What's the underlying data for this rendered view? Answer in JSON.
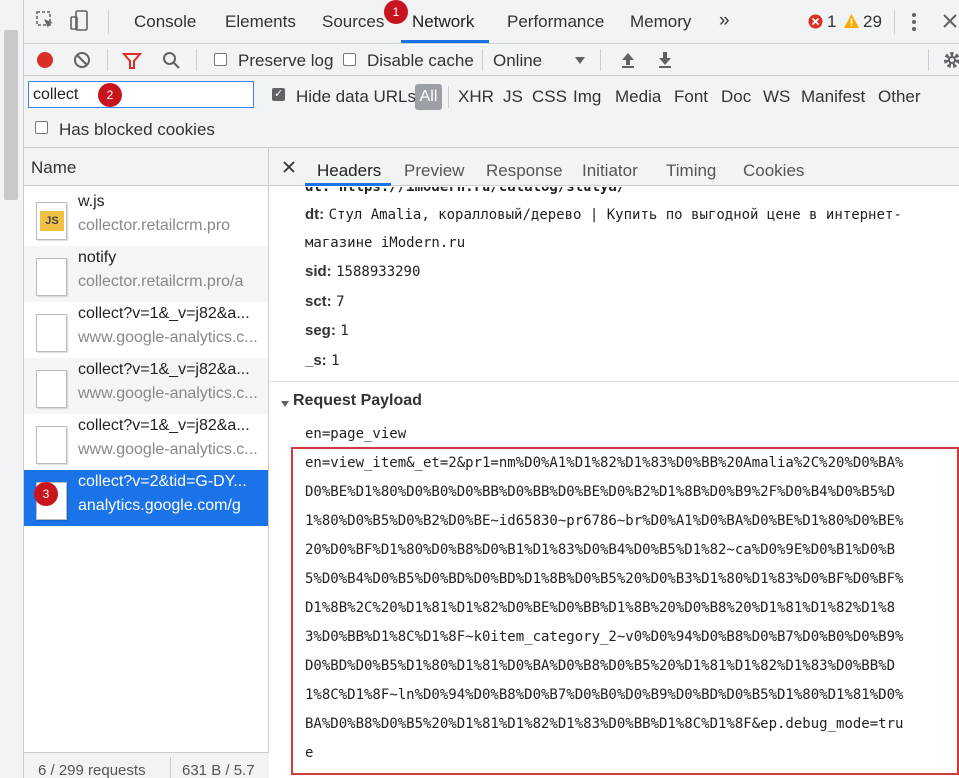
{
  "top_tabs": {
    "console": "Console",
    "elements": "Elements",
    "sources": "Sources",
    "network": "Network",
    "performance": "Performance",
    "memory": "Memory",
    "more": "»",
    "errors": "1",
    "warnings": "29"
  },
  "badges": {
    "one": "1",
    "two": "2",
    "three": "3"
  },
  "toolbar": {
    "preserve_log": "Preserve log",
    "disable_cache": "Disable cache",
    "throttle": "Online"
  },
  "filter": {
    "value": "collect",
    "hide_data_urls": "Hide data URLs",
    "types": [
      "All",
      "XHR",
      "JS",
      "CSS",
      "Img",
      "Media",
      "Font",
      "Doc",
      "WS",
      "Manifest",
      "Other"
    ],
    "blocked_cookies": "Has blocked cookies"
  },
  "requests": {
    "header": "Name",
    "items": [
      {
        "name": "w.js",
        "host": "collector.retailcrm.pro"
      },
      {
        "name": "notify",
        "host": "collector.retailcrm.pro/a"
      },
      {
        "name": "collect?v=1&_v=j82&a...",
        "host": "www.google-analytics.c..."
      },
      {
        "name": "collect?v=1&_v=j82&a...",
        "host": "www.google-analytics.c..."
      },
      {
        "name": "collect?v=1&_v=j82&a...",
        "host": "www.google-analytics.c..."
      },
      {
        "name": "collect?v=2&tid=G-DY...",
        "host": "analytics.google.com/g"
      }
    ],
    "status": "6 / 299 requests",
    "size": "631 B / 5.7"
  },
  "detail_tabs": [
    "Headers",
    "Preview",
    "Response",
    "Initiator",
    "Timing",
    "Cookies"
  ],
  "params": {
    "dl_partial": "dl: https://imodern.ru/catalog/stulya/",
    "dt_key": "dt:",
    "dt_val": "Стул Amalia, коралловый/дерево | Купить по выгодной цене в интернет-",
    "dt_val2": "магазине iModern.ru",
    "sid_key": "sid:",
    "sid_val": "1588933290",
    "sct_key": "sct:",
    "sct_val": "7",
    "seg_key": "seg:",
    "seg_val": "1",
    "s_key": "_s:",
    "s_val": "1"
  },
  "payload": {
    "title": "Request Payload",
    "lines": [
      "en=page_view",
      "en=view_item&_et=2&pr1=nm%D0%A1%D1%82%D1%83%D0%BB%20Amalia%2C%20%D0%BA%",
      "D0%BE%D1%80%D0%B0%D0%BB%D0%BB%D0%BE%D0%B2%D1%8B%D0%B9%2F%D0%B4%D0%B5%D",
      "1%80%D0%B5%D0%B2%D0%BE~id65830~pr6786~br%D0%A1%D0%BA%D0%BE%D1%80%D0%BE%",
      "20%D0%BF%D1%80%D0%B8%D0%B1%D1%83%D0%B4%D0%B5%D1%82~ca%D0%9E%D0%B1%D0%B",
      "5%D0%B4%D0%B5%D0%BD%D0%BD%D1%8B%D0%B5%20%D0%B3%D1%80%D1%83%D0%BF%D0%BF%",
      "D1%8B%2C%20%D1%81%D1%82%D0%BE%D0%BB%D1%8B%20%D0%B8%20%D1%81%D1%82%D1%8",
      "3%D0%BB%D1%8C%D1%8F~k0item_category_2~v0%D0%94%D0%B8%D0%B7%D0%B0%D0%B9%",
      "D0%BD%D0%B5%D1%80%D1%81%D0%BA%D0%B8%D0%B5%20%D1%81%D1%82%D1%83%D0%BB%D",
      "1%8C%D1%8F~ln%D0%94%D0%B8%D0%B7%D0%B0%D0%B9%D0%BD%D0%B5%D1%80%D1%81%D0%",
      "BA%D0%B8%D0%B5%20%D1%81%D1%82%D1%83%D0%BB%D1%8C%D1%8F&ep.debug_mode=tru",
      "e"
    ]
  },
  "colors": {
    "accent": "#1a73e8",
    "record": "#d93025",
    "badge": "#c8141e",
    "highlight_box": "#d03a3a"
  }
}
